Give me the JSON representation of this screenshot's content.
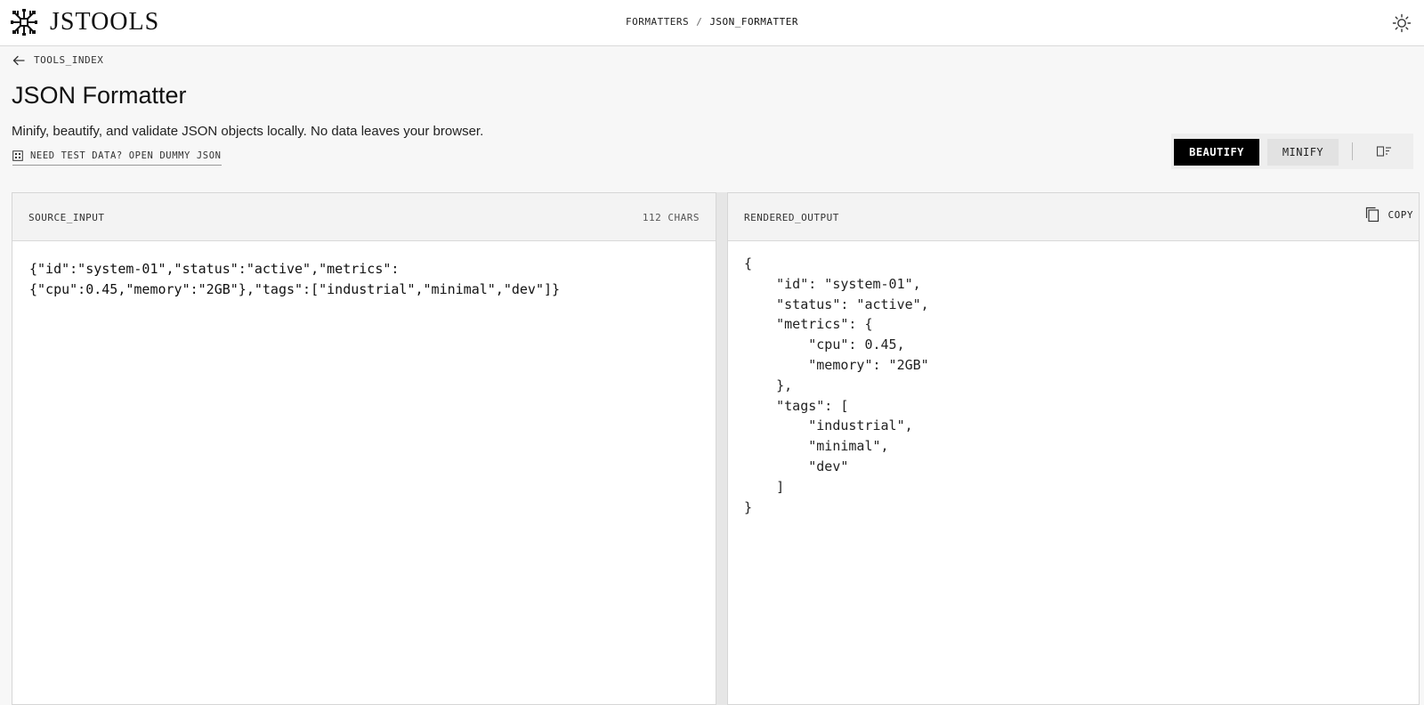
{
  "app": {
    "name": "JSTOOLS"
  },
  "breadcrumb": {
    "parent": "FORMATTERS",
    "separator": "/",
    "current": "JSON_FORMATTER"
  },
  "nav": {
    "back_label": "TOOLS_INDEX"
  },
  "page": {
    "title": "JSON Formatter",
    "subtitle": "Minify, beautify, and validate JSON objects locally. No data leaves your browser.",
    "dummy_link": "NEED TEST DATA? OPEN DUMMY JSON"
  },
  "toolbar": {
    "beautify_label": "BEAUTIFY",
    "minify_label": "MINIFY",
    "active_mode": "BEAUTIFY"
  },
  "source_panel": {
    "title": "SOURCE_INPUT",
    "char_count": "112 CHARS",
    "value": "{\"id\":\"system-01\",\"status\":\"active\",\"metrics\":\n{\"cpu\":0.45,\"memory\":\"2GB\"},\"tags\":[\"industrial\",\"minimal\",\"dev\"]}"
  },
  "output_panel": {
    "title": "RENDERED_OUTPUT",
    "copy_label": "COPY",
    "value": "{\n    \"id\": \"system-01\",\n    \"status\": \"active\",\n    \"metrics\": {\n        \"cpu\": 0.45,\n        \"memory\": \"2GB\"\n    },\n    \"tags\": [\n        \"industrial\",\n        \"minimal\",\n        \"dev\"\n    ]\n}"
  },
  "icons": {
    "logo": "circuit-logo-icon",
    "theme": "sun-icon",
    "back": "arrow-left-icon",
    "dummy": "grid-icon",
    "clear": "clear-trash-icon",
    "copy": "copy-icon"
  },
  "colors": {
    "background": "#f7f7f7",
    "primary_button": "#000000",
    "primary_button_text": "#ffffff",
    "secondary_button": "#e2e2e2"
  }
}
